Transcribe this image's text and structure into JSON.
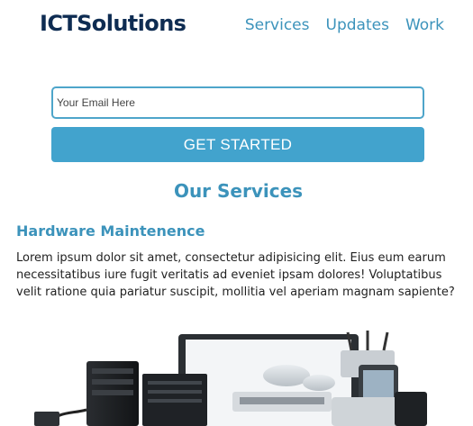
{
  "header": {
    "logo": "ICTSolutions",
    "nav": [
      "Services",
      "Updates",
      "Work"
    ]
  },
  "signup": {
    "email_placeholder": "Your Email Here",
    "button_label": "GET STARTED"
  },
  "services": {
    "title": "Our Services",
    "items": [
      {
        "title": "Hardware Maintenence",
        "description": "Lorem ipsum dolor sit amet, consectetur adipisicing elit. Eius eum earum necessitatibus iure fugit veritatis ad eveniet ipsam dolores! Voluptatibus velit ratione quia pariatur suscipit, mollitia vel aperiam magnam sapiente?"
      }
    ]
  },
  "colors": {
    "brand_dark": "#0e2c52",
    "accent": "#42a3cd",
    "link": "#3c93bb"
  }
}
